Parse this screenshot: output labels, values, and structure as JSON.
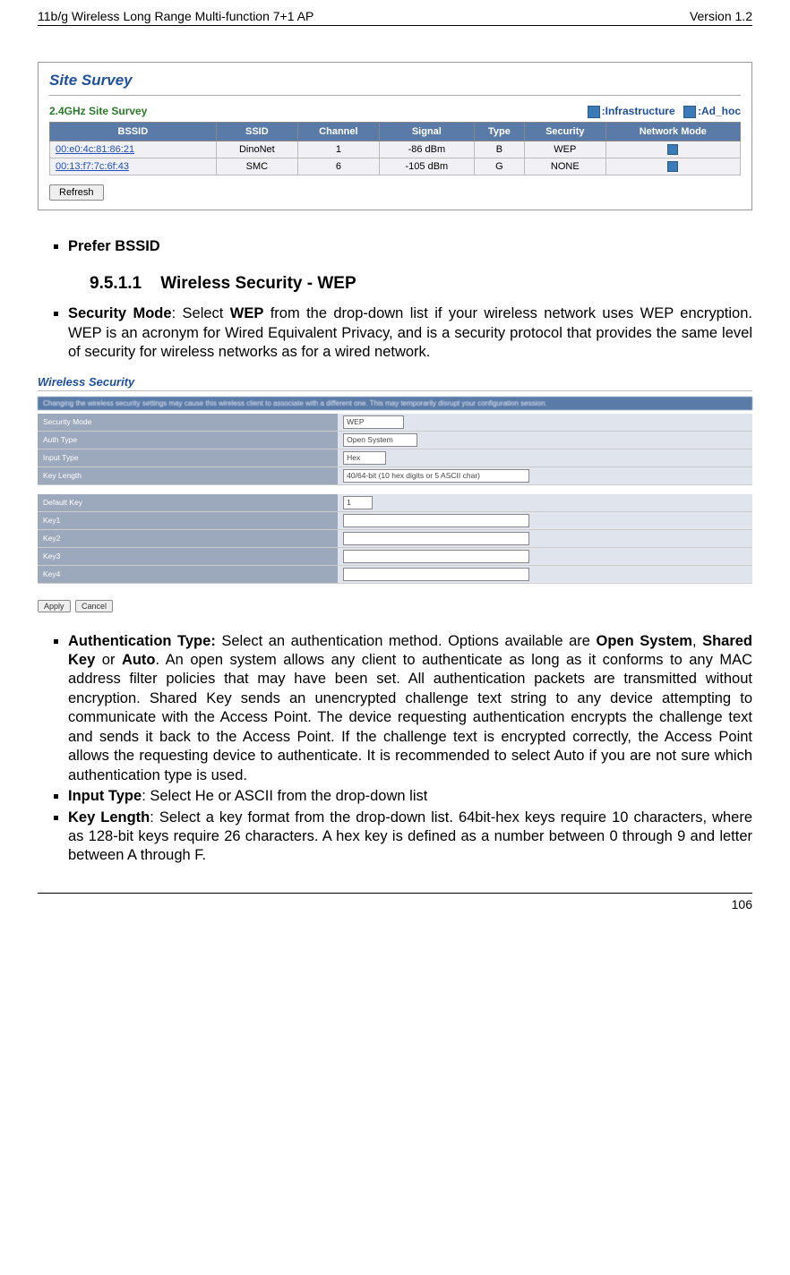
{
  "header": {
    "left": "11b/g Wireless Long Range Multi-function 7+1 AP",
    "right": "Version 1.2"
  },
  "footer": {
    "page": "106"
  },
  "site_survey": {
    "title": "Site Survey",
    "legend_left": "2.4GHz Site Survey",
    "legend_infra": ":Infrastructure",
    "legend_adhoc": ":Ad_hoc",
    "headers": [
      "BSSID",
      "SSID",
      "Channel",
      "Signal",
      "Type",
      "Security",
      "Network Mode"
    ],
    "rows": [
      {
        "bssid": "00:e0:4c:81:86:21",
        "ssid": "DinoNet",
        "channel": "1",
        "signal": "-86 dBm",
        "type": "B",
        "security": "WEP"
      },
      {
        "bssid": "00:13:f7:7c:6f:43",
        "ssid": "SMC",
        "channel": "6",
        "signal": "-105 dBm",
        "type": "G",
        "security": "NONE"
      }
    ],
    "refresh": "Refresh"
  },
  "bullet_prefer": "Prefer BSSID",
  "section": {
    "number": "9.5.1.1",
    "title": "Wireless Security - WEP"
  },
  "bullet_security_mode": {
    "label": "Security Mode",
    "sep": ": Select ",
    "bold2": "WEP",
    "rest": " from the drop-down list if your wireless network uses WEP encryption. WEP is an acronym for Wired Equivalent Privacy, and is a security protocol that provides the same level of security for wireless networks as for a wired network."
  },
  "wsec": {
    "title": "Wireless Security",
    "banner": "Changing the wireless security settings may cause this wireless client to associate with a different one. This may temporarily disrupt your configuration session.",
    "rows": {
      "security_mode": {
        "label": "Security Mode",
        "value": "WEP"
      },
      "auth_type": {
        "label": "Auth Type",
        "value": "Open System"
      },
      "input_type": {
        "label": "Input Type",
        "value": "Hex"
      },
      "key_length": {
        "label": "Key Length",
        "value": "40/64-bit (10 hex digits or 5 ASCII char)"
      },
      "default_key": {
        "label": "Default Key",
        "value": "1"
      },
      "key1": {
        "label": "Key1",
        "value": ""
      },
      "key2": {
        "label": "Key2",
        "value": ""
      },
      "key3": {
        "label": "Key3",
        "value": ""
      },
      "key4": {
        "label": "Key4",
        "value": ""
      }
    },
    "apply": "Apply",
    "cancel": "Cancel"
  },
  "bullets_after": {
    "auth": {
      "label": "Authentication Type:",
      "pre": " Select an authentication method. Options available are ",
      "b1": "Open System",
      "sep1": ", ",
      "b2": "Shared Key",
      "sep2": " or ",
      "b3": "Auto",
      "rest": ". An open system allows any client to authenticate as long as it conforms to any MAC address filter policies that may have been set. All authentication packets are transmitted without encryption. Shared Key sends an unencrypted challenge text string to any device attempting to communicate with the Access Point. The device requesting authentication encrypts the challenge text and sends it back to the Access Point. If the challenge text is encrypted correctly, the Access Point allows the requesting device to authenticate. It is recommended to select Auto if you are not sure which authentication type is used."
    },
    "input": {
      "label": "Input Type",
      "rest": ": Select He or ASCII from the drop-down list"
    },
    "keylen": {
      "label": "Key Length",
      "rest": ": Select a key format from the drop-down list. 64bit-hex keys require 10 characters, where as 128-bit keys require 26 characters. A hex key is defined as a number between 0 through 9 and letter between A through F."
    }
  }
}
